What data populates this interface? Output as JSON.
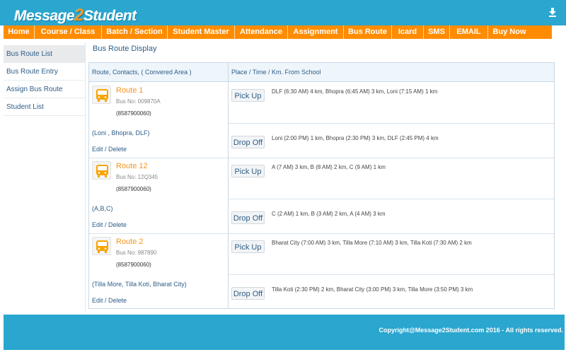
{
  "header": {
    "logo_prefix": "Message",
    "logo_two": "2",
    "logo_suffix": "Student"
  },
  "nav": {
    "items": [
      "Home",
      "Course / Class",
      "Batch / Section",
      "Student Master",
      "Attendance",
      "Assignment",
      "Bus Route",
      "Icard",
      "SMS",
      "EMAIL",
      "Buy Now"
    ]
  },
  "sidebar": {
    "items": [
      {
        "label": "Bus Route List"
      },
      {
        "label": "Bus Route Entry"
      },
      {
        "label": "Assign Bus Route"
      },
      {
        "label": "Student List"
      }
    ]
  },
  "main": {
    "title": "Bus Route Display",
    "columns": [
      "Route, Contacts, ( Convered Area )",
      "Place / Time / Km. From School"
    ],
    "edit_label": "Edit / Delete",
    "routes": [
      {
        "name": "Route 1",
        "bus_no": "Bus No: 009870A",
        "phone": "(8587900060)",
        "area": "(Loni , Bhopra, DLF)",
        "pickup_label": "Pick Up",
        "pickup_text": "DLF (6:30 AM) 4 km, Bhopra (6:45 AM) 3 km, Loni (7:15 AM) 1 km",
        "drop_label": "Drop Off",
        "drop_text": "Loni (2:00 PM) 1 km, Bhopra (2:30 PM) 3 km, DLF (2:45 PM) 4 km"
      },
      {
        "name": "Route 12",
        "bus_no": "Bus No: 12Q345",
        "phone": "(8587900060)",
        "area": "(A,B,C)",
        "pickup_label": "Pick Up",
        "pickup_text": "A (7 AM) 3 km, B (8 AM) 2 km, C (9 AM) 1 km",
        "drop_label": "Drop Off",
        "drop_text": "C (2 AM) 1 km, B (3 AM) 2 km, A (4 AM) 3 km"
      },
      {
        "name": "Route 2",
        "bus_no": "Bus No: 987890",
        "phone": "(8587900060)",
        "area": "(Tilla More, Tilla Koti, Bharat City)",
        "pickup_label": "Pick Up",
        "pickup_text": "Bharat City (7:00 AM) 3 km, Tilla More (7:10 AM) 3 km, Tilla Koti (7:30 AM) 2 km",
        "drop_label": "Drop Off",
        "drop_text": "Tilla Koti (2:30 PM) 2 km, Bharat City (3:00 PM) 3 km, Tilla More (3:50 PM) 3 km"
      }
    ]
  },
  "footer": {
    "copyright": "Copyright@Message2Student.com 2016 - All rights reserved."
  },
  "colors": {
    "header_blue": "#2aa6cf",
    "nav_orange": "#ff8c00",
    "route_orange": "#f7941d",
    "link_blue": "#2d5d86"
  },
  "icons": [
    "download-icon",
    "bus-icon"
  ]
}
